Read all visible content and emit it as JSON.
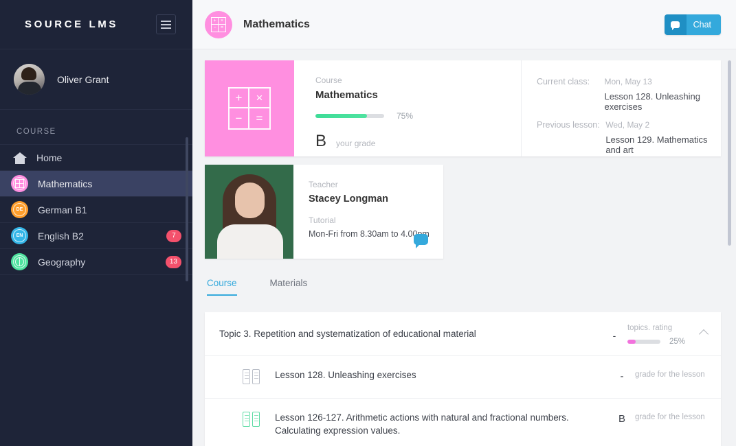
{
  "sidebar": {
    "logo": "SOURCE LMS",
    "menu_icon": "hamburger-icon",
    "user": {
      "name": "Oliver Grant"
    },
    "section_label": "COURSE",
    "items": [
      {
        "label": "Home",
        "icon": "home-icon",
        "badge": "",
        "active": false
      },
      {
        "label": "Mathematics",
        "icon": "math-grid-icon",
        "badge": "",
        "active": true,
        "color": "#ff8fe0"
      },
      {
        "label": "German B1",
        "icon": "de-icon",
        "badge": "",
        "active": false,
        "color": "#ff9e2c",
        "abbr": "DE"
      },
      {
        "label": "English B2",
        "icon": "en-icon",
        "badge": "7",
        "active": false,
        "color": "#34b6e8",
        "abbr": "EN"
      },
      {
        "label": "Geography",
        "icon": "globe-icon",
        "badge": "13",
        "active": false,
        "color": "#4fe3a0"
      }
    ]
  },
  "topbar": {
    "course_icon": "math-grid-icon",
    "title": "Mathematics",
    "chat_label": "Chat",
    "chat_icon": "chat-bubble-icon"
  },
  "course_card": {
    "tile_symbols": [
      "+",
      "×",
      "−",
      "="
    ],
    "course_label": "Course",
    "course_name": "Mathematics",
    "progress_percent": "75%",
    "progress_value": 75,
    "grade_letter": "B",
    "grade_caption": "your grade",
    "current_class_label": "Current class:",
    "current_class_date": "Mon, May 13",
    "current_class_title": "Lesson 128. Unleashing exercises",
    "previous_lesson_label": "Previous lesson:",
    "previous_lesson_date": "Wed, May 2",
    "previous_lesson_title": "Lesson  129. Mathematics and art",
    "check_icon": "checkmark-icon"
  },
  "teacher_card": {
    "teacher_label": "Teacher",
    "teacher_name": "Stacey Longman",
    "tutorial_label": "Tutorial",
    "tutorial_time": "Mon-Fri from 8.30am to 4.00pm",
    "message_icon": "chat-bubble-icon"
  },
  "tabs": [
    {
      "label": "Course",
      "active": true
    },
    {
      "label": "Materials",
      "active": false
    }
  ],
  "topic": {
    "title": "Topic 3. Repetition and systematization of educational material",
    "rating_mark": "-",
    "rating_label": "topics. rating",
    "rating_percent": "25%",
    "rating_value": 25,
    "collapse_icon": "chevron-up-icon"
  },
  "lessons": [
    {
      "icon": "book-icon",
      "icon_color": "#b9bec7",
      "title": "Lesson 128. Unleashing exercises",
      "grade_mark": "-",
      "grade_caption": "grade for the lesson"
    },
    {
      "icon": "book-icon",
      "icon_color": "#5fdca6",
      "title": "Lesson 126-127. Arithmetic actions with natural and fractional numbers. Calculating expression values.",
      "grade_mark": "B",
      "grade_caption": "grade for the lesson"
    }
  ],
  "colors": {
    "sidebar_bg": "#1e2438",
    "sidebar_active": "#3a4263",
    "accent_blue": "#34a9dc",
    "accent_pink": "#ff8fe0",
    "progress_green": "#3ddc97",
    "badge_red": "#f4516c",
    "rating_pink": "#f272dd"
  }
}
